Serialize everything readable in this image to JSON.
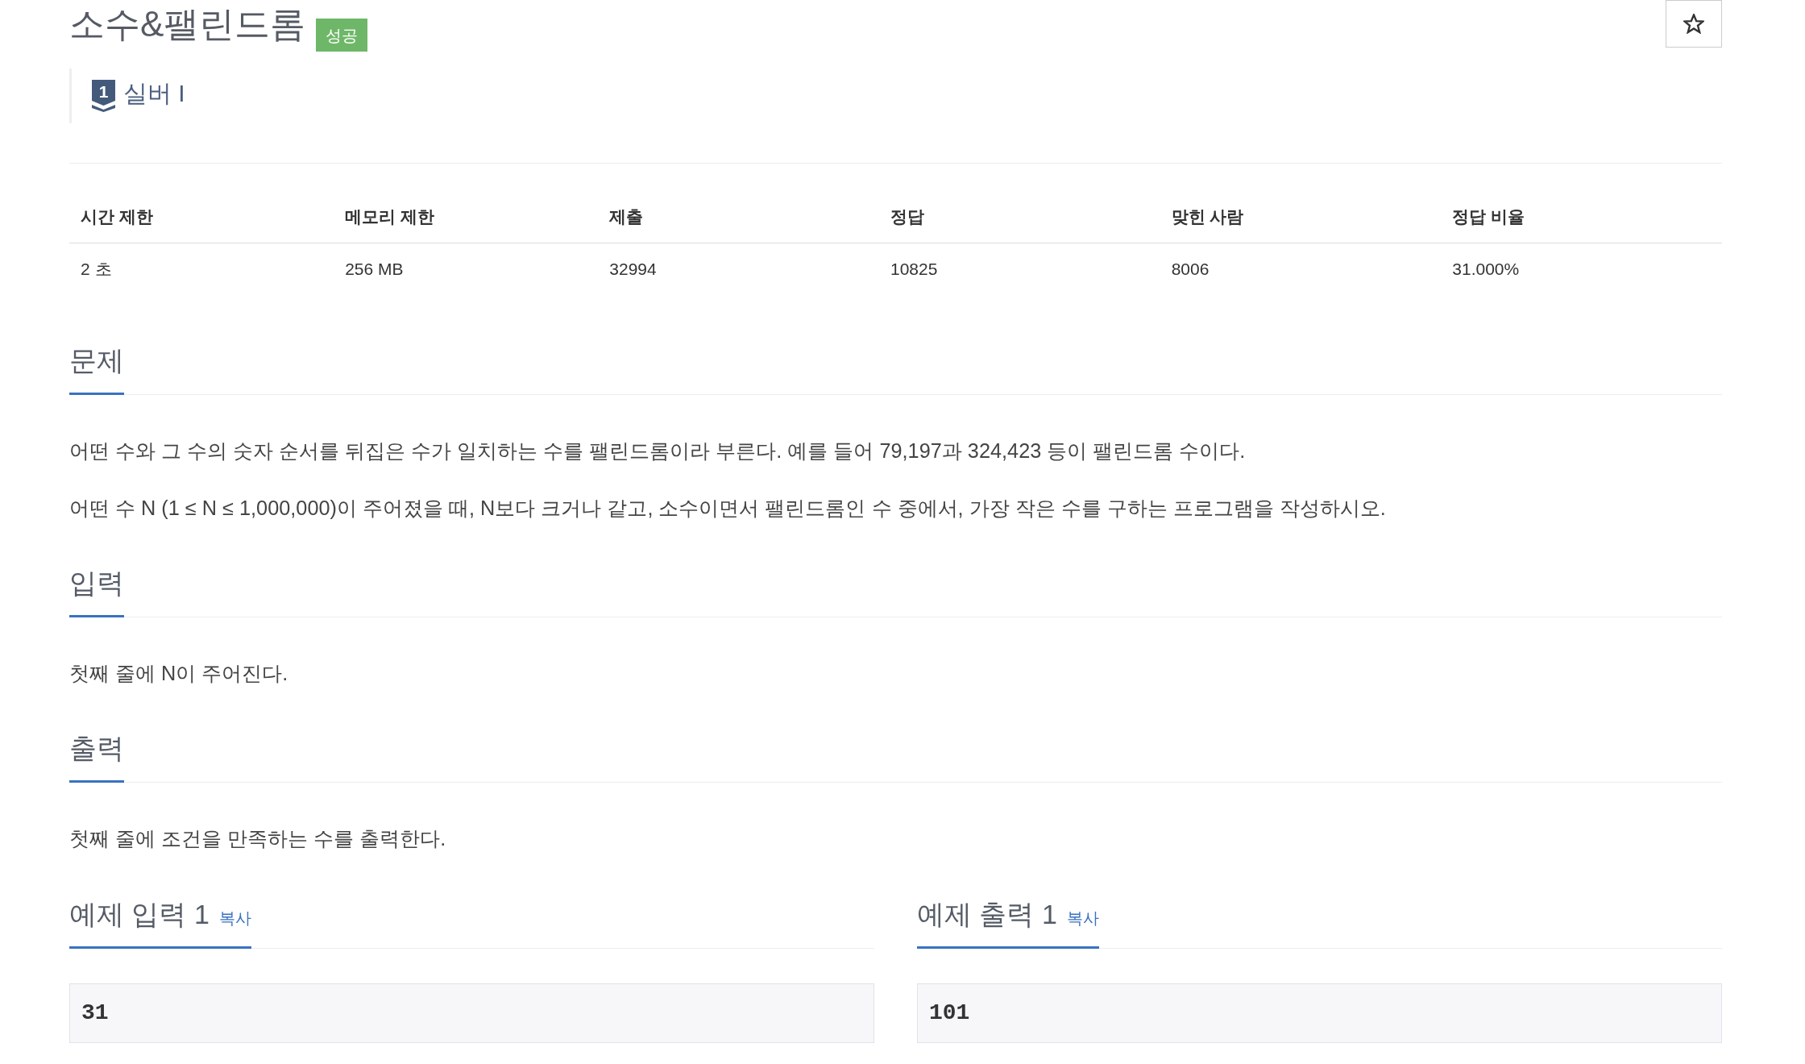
{
  "header": {
    "title": "소수&팰린드롬",
    "badge": "성공"
  },
  "tier": {
    "icon_number": "1",
    "name": "실버 I"
  },
  "info_table": {
    "columns": [
      "시간 제한",
      "메모리 제한",
      "제출",
      "정답",
      "맞힌 사람",
      "정답 비율"
    ],
    "rows": [
      [
        "2 초",
        "256 MB",
        "32994",
        "10825",
        "8006",
        "31.000%"
      ]
    ]
  },
  "sections": [
    {
      "title": "문제",
      "paragraphs": [
        "어떤 수와 그 수의 숫자 순서를 뒤집은 수가 일치하는 수를 팰린드롬이라 부른다. 예를 들어 79,197과 324,423 등이 팰린드롬 수이다.",
        "어떤 수 N (1 ≤ N ≤ 1,000,000)이 주어졌을 때, N보다 크거나 같고, 소수이면서 팰린드롬인 수 중에서, 가장 작은 수를 구하는 프로그램을 작성하시오."
      ]
    },
    {
      "title": "입력",
      "paragraphs": [
        "첫째 줄에 N이 주어진다."
      ]
    },
    {
      "title": "출력",
      "paragraphs": [
        "첫째 줄에 조건을 만족하는 수를 출력한다."
      ]
    }
  ],
  "samples": [
    {
      "title": "예제 입력 1",
      "copy_link": "복사",
      "content": "31"
    },
    {
      "title": "예제 출력 1",
      "copy_link": "복사",
      "content": "101"
    }
  ]
}
